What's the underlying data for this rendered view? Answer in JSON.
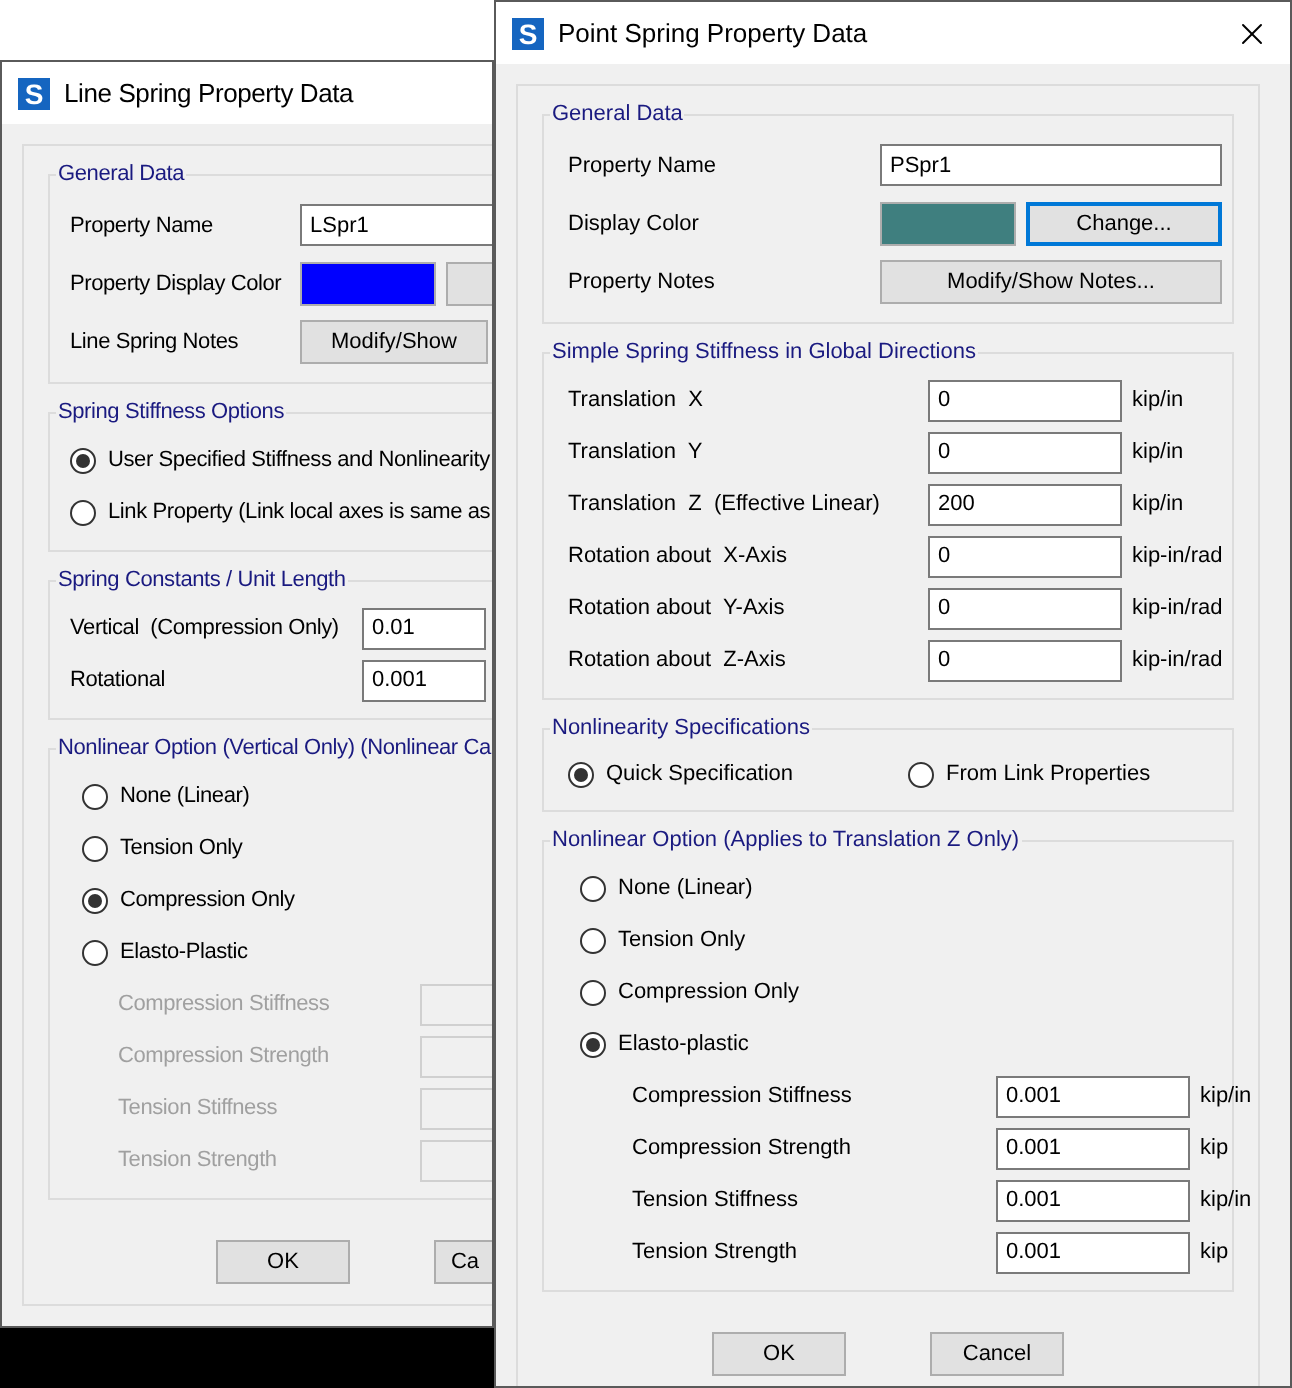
{
  "windows": [
    {
      "title": "Line Spring Property Data",
      "app_icon": "S",
      "closable": false,
      "sections": [
        {
          "kind": "general",
          "title": "General Data",
          "rows": [
            {
              "kind": "text",
              "label": "Property Name",
              "value": "LSpr1"
            },
            {
              "kind": "color",
              "label": "Property Display Color",
              "color": "#0000ff"
            },
            {
              "kind": "button",
              "label": "Line Spring Notes",
              "button": "Modify/Show"
            }
          ]
        },
        {
          "kind": "radios",
          "title": "Spring Stiffness Options",
          "options": [
            {
              "label": "User Specified Stiffness and Nonlinearity",
              "selected": true
            },
            {
              "label": "Link Property (Link local axes is same as",
              "selected": false
            }
          ]
        },
        {
          "kind": "values",
          "title": "Spring Constants / Unit Length",
          "rows": [
            {
              "label": "Vertical  (Compression Only)",
              "value": "0.01",
              "disabled": false
            },
            {
              "label": "Rotational",
              "value": "0.001",
              "disabled": false
            }
          ]
        },
        {
          "kind": "nonlinear",
          "title": "Nonlinear Option  (Vertical Only)  (Nonlinear Ca",
          "options": [
            {
              "label": "None (Linear)",
              "selected": false
            },
            {
              "label": "Tension Only",
              "selected": false
            },
            {
              "label": "Compression Only",
              "selected": true
            },
            {
              "label": "Elasto-Plastic",
              "selected": false
            }
          ],
          "rows": [
            {
              "label": "Compression Stiffness",
              "disabled": true
            },
            {
              "label": "Compression Strength",
              "disabled": true
            },
            {
              "label": "Tension Stiffness",
              "disabled": true
            },
            {
              "label": "Tension Strength",
              "disabled": true
            }
          ]
        }
      ],
      "buttons": [
        "OK",
        "Ca"
      ]
    },
    {
      "title": "Point Spring Property Data",
      "app_icon": "S",
      "closable": true,
      "sections": [
        {
          "kind": "general",
          "title": "General Data",
          "rows": [
            {
              "kind": "text",
              "label": "Property Name",
              "value": "PSpr1"
            },
            {
              "kind": "color",
              "label": "Display Color",
              "color": "#3f7f7f",
              "button": "Change...",
              "focused": true
            },
            {
              "kind": "button",
              "label": "Property Notes",
              "button": "Modify/Show Notes..."
            }
          ]
        },
        {
          "kind": "values",
          "title": "Simple Spring Stiffness in Global Directions",
          "rows": [
            {
              "label": "Translation  X",
              "value": "0",
              "unit": "kip/in",
              "disabled": false
            },
            {
              "label": "Translation  Y",
              "value": "0",
              "unit": "kip/in",
              "disabled": false
            },
            {
              "label": "Translation  Z  (Effective Linear)",
              "value": "200",
              "unit": "kip/in",
              "disabled": false
            },
            {
              "label": "Rotation about  X-Axis",
              "value": "0",
              "unit": "kip-in/rad",
              "disabled": false
            },
            {
              "label": "Rotation about  Y-Axis",
              "value": "0",
              "unit": "kip-in/rad",
              "disabled": false
            },
            {
              "label": "Rotation about  Z-Axis",
              "value": "0",
              "unit": "kip-in/rad",
              "disabled": false
            }
          ]
        },
        {
          "kind": "inline_radios",
          "title": "Nonlinearity Specifications",
          "options": [
            {
              "label": "Quick Specification",
              "selected": true
            },
            {
              "label": "From Link Properties",
              "selected": false
            }
          ]
        },
        {
          "kind": "nonlinear",
          "title": "Nonlinear Option  (Applies to Translation Z Only)",
          "options": [
            {
              "label": "None (Linear)",
              "selected": false
            },
            {
              "label": "Tension Only",
              "selected": false
            },
            {
              "label": "Compression Only",
              "selected": false
            },
            {
              "label": "Elasto-plastic",
              "selected": true
            }
          ],
          "rows": [
            {
              "label": "Compression Stiffness",
              "value": "0.001",
              "unit": "kip/in",
              "disabled": false
            },
            {
              "label": "Compression Strength",
              "value": "0.001",
              "unit": "kip",
              "disabled": false
            },
            {
              "label": "Tension Stiffness",
              "value": "0.001",
              "unit": "kip/in",
              "disabled": false
            },
            {
              "label": "Tension Strength",
              "value": "0.001",
              "unit": "kip",
              "disabled": false
            }
          ]
        }
      ],
      "buttons": [
        "OK",
        "Cancel"
      ]
    }
  ]
}
